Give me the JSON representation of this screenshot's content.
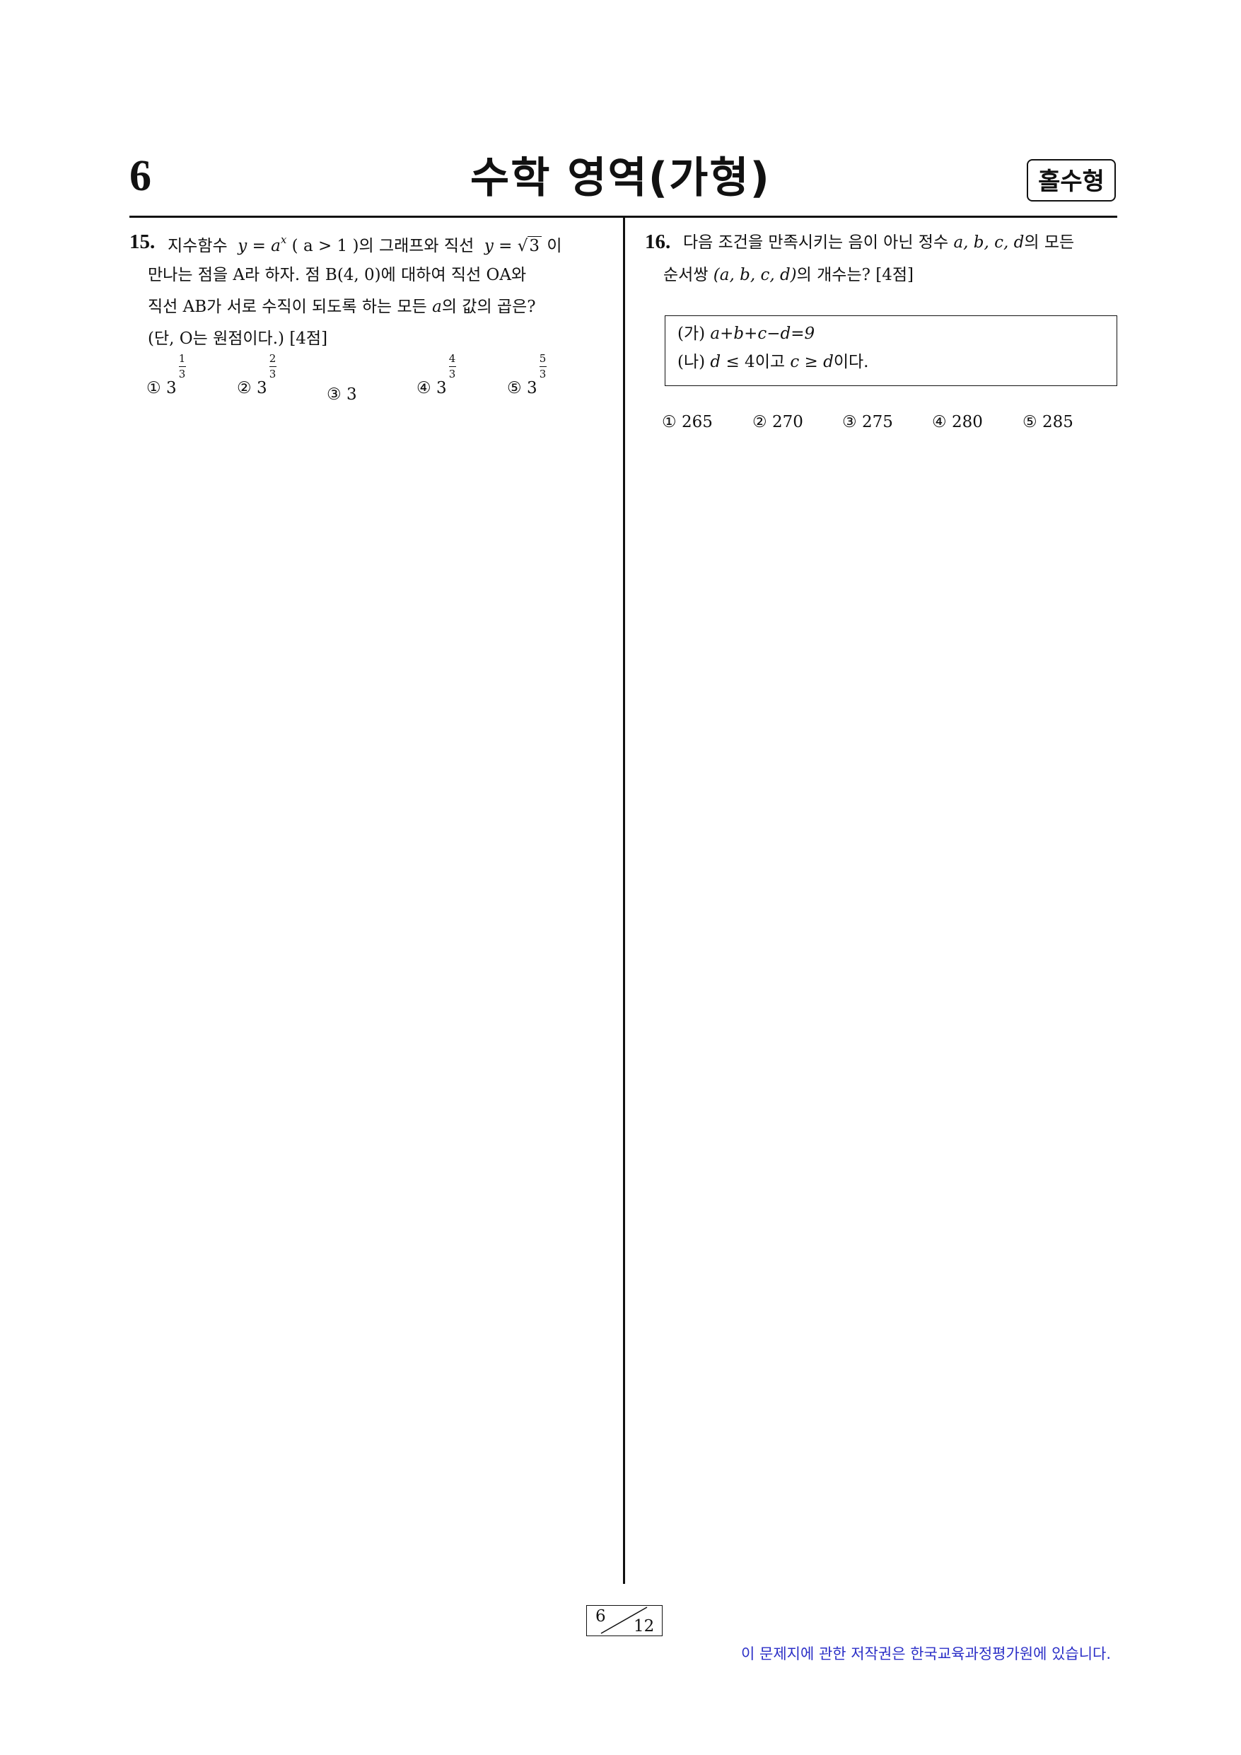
{
  "header": {
    "page_number": "6",
    "section_title": "수학 영역(가형)",
    "type_badge": "홀수형"
  },
  "problem15": {
    "number": "15.",
    "line1_a": "지수함수",
    "line1_eq_y": "y",
    "line1_eq_eq": " = ",
    "line1_eq_a": "a",
    "line1_eq_exp": "x",
    "line1_cond": "( a > 1 )",
    "line1_b": "의 그래프와 직선",
    "line1_y2": "y",
    "line1_eq2": " = ",
    "line1_sqrt_sym": "√",
    "line1_sqrt_val": "3",
    "line1_c": "이",
    "line2": "만나는 점을 A라 하자. 점 B(4, 0)에 대하여 직선 OA와",
    "line3_a": "직선 AB가 서로 수직이 되도록 하는 모든",
    "line3_var": "a",
    "line3_b": "의 값의 곱은?",
    "line4": "(단, O는 원점이다.) [4점]",
    "choices": [
      {
        "mark": "①",
        "base": "3",
        "num": "1",
        "den": "3"
      },
      {
        "mark": "②",
        "base": "3",
        "num": "2",
        "den": "3"
      },
      {
        "mark": "③",
        "base": "3"
      },
      {
        "mark": "④",
        "base": "3",
        "num": "4",
        "den": "3"
      },
      {
        "mark": "⑤",
        "base": "3",
        "num": "5",
        "den": "3"
      }
    ]
  },
  "problem16": {
    "number": "16.",
    "line1_a": "다음 조건을 만족시키는 음이 아닌 정수",
    "line1_vars": "a, b, c, d",
    "line1_b": "의 모든",
    "line2_a": "순서쌍",
    "line2_tuple": "(a, b, c, d)",
    "line2_b": "의 개수는? [4점]",
    "cond_a_label": "(가)",
    "cond_a_expr": "a+b+c−d=9",
    "cond_b_label": "(나)",
    "cond_b_d": "d",
    "cond_b_le": " ≤ 4",
    "cond_b_mid": "이고",
    "cond_b_c": "c",
    "cond_b_ge": " ≥ ",
    "cond_b_d2": "d",
    "cond_b_end": "이다.",
    "choices": [
      {
        "mark": "①",
        "value": "265"
      },
      {
        "mark": "②",
        "value": "270"
      },
      {
        "mark": "③",
        "value": "275"
      },
      {
        "mark": "④",
        "value": "280"
      },
      {
        "mark": "⑤",
        "value": "285"
      }
    ]
  },
  "footer": {
    "page_current": "6",
    "page_total": "12",
    "copyright": "이 문제지에 관한 저작권은 한국교육과정평가원에 있습니다."
  }
}
